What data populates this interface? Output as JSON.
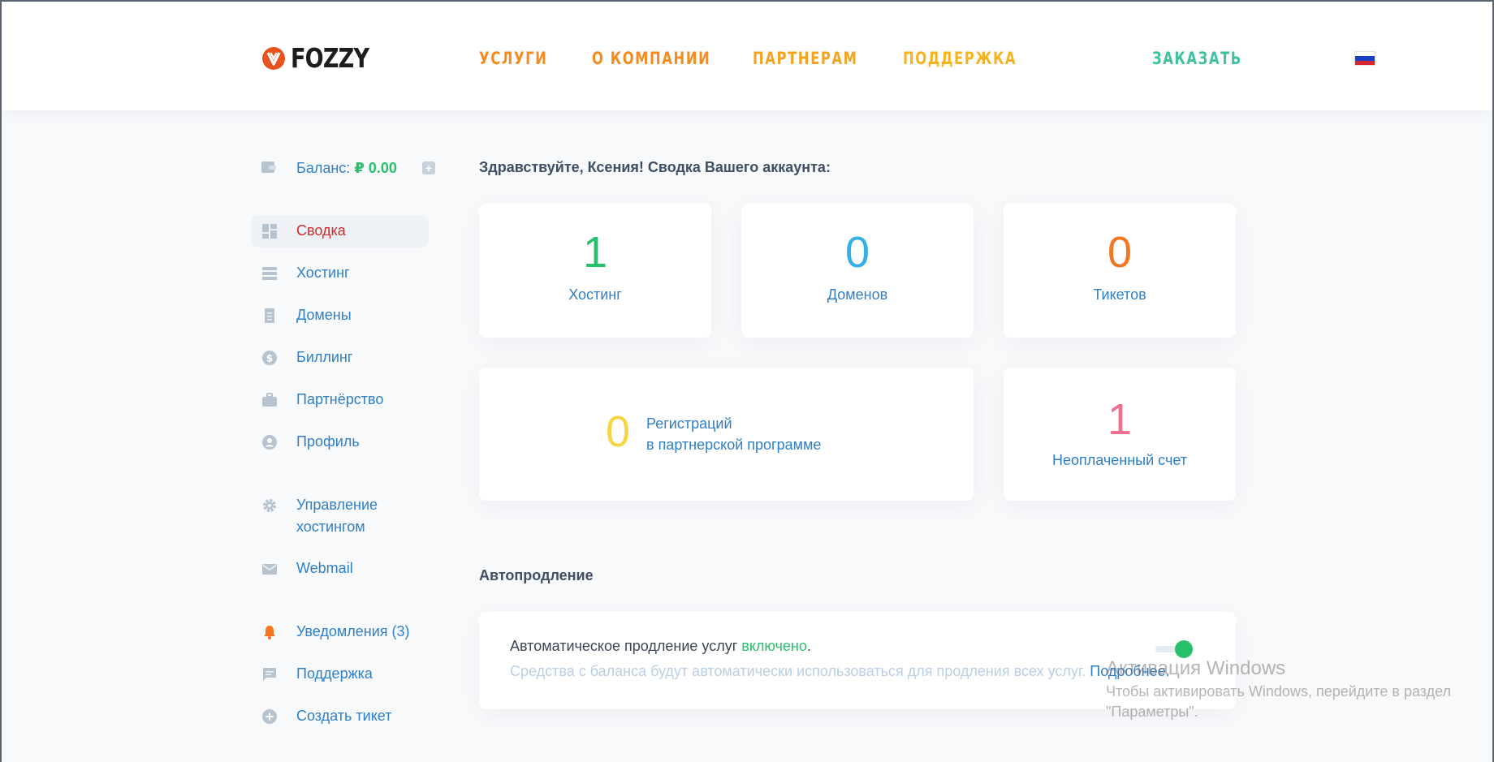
{
  "header": {
    "logo_text": "FOZZY",
    "nav": [
      {
        "label": "УСЛУГИ",
        "color": "#f58a1f"
      },
      {
        "label": "О КОМПАНИИ",
        "color": "#f58a1f"
      },
      {
        "label": "ПАРТНЕРАМ",
        "color": "#f5a31f"
      },
      {
        "label": "ПОДДЕРЖКА",
        "color": "#f5b31f"
      }
    ],
    "order_label": "ЗАКАЗАТЬ",
    "order_color": "#3fc0a0",
    "language_flag": "flag-ru-icon"
  },
  "sidebar": {
    "balance_label": "Баланс: ",
    "balance_amount": "₽ 0.00",
    "items": [
      {
        "label": "Сводка",
        "icon": "dashboard-icon"
      },
      {
        "label": "Хостинг",
        "icon": "server-icon"
      },
      {
        "label": "Домены",
        "icon": "document-icon"
      },
      {
        "label": "Биллинг",
        "icon": "dollar-icon"
      },
      {
        "label": "Партнёрство",
        "icon": "briefcase-icon"
      },
      {
        "label": "Профиль",
        "icon": "user-icon"
      },
      {
        "label": "Управление",
        "label2": "хостингом",
        "icon": "gear-icon"
      },
      {
        "label": "Webmail",
        "icon": "mail-icon"
      },
      {
        "label": "Уведомления (3)",
        "icon": "bell-icon"
      },
      {
        "label": "Поддержка",
        "icon": "chat-icon"
      },
      {
        "label": "Создать тикет",
        "icon": "plus-circle-icon"
      }
    ]
  },
  "main": {
    "greeting": "Здравствуйте, Ксения! Сводка Вашего аккаунта:",
    "stats": [
      {
        "value": "1",
        "label": "Хостинг",
        "color": "#27c16c"
      },
      {
        "value": "0",
        "label": "Доменов",
        "color": "#33aee8"
      },
      {
        "value": "0",
        "label": "Тикетов",
        "color": "#f5761f"
      }
    ],
    "partner": {
      "value": "0",
      "line1": "Регистраций",
      "line2": "в партнерской программе",
      "color": "#f7d542"
    },
    "invoice": {
      "value": "1",
      "label": "Неоплаченный счет",
      "color": "#f06e8e"
    },
    "autorenew": {
      "title": "Автопродление",
      "text": "Автоматическое продление услуг ",
      "status": "включено",
      "period": ".",
      "description": "Средства с баланса будут автоматически использоваться для продления всех услуг. ",
      "more": "Подробнее.",
      "enabled": true
    }
  },
  "watermark": {
    "title": "Активация Windows",
    "line1": "Чтобы активировать Windows, перейдите в раздел",
    "line2": "\"Параметры\"."
  }
}
